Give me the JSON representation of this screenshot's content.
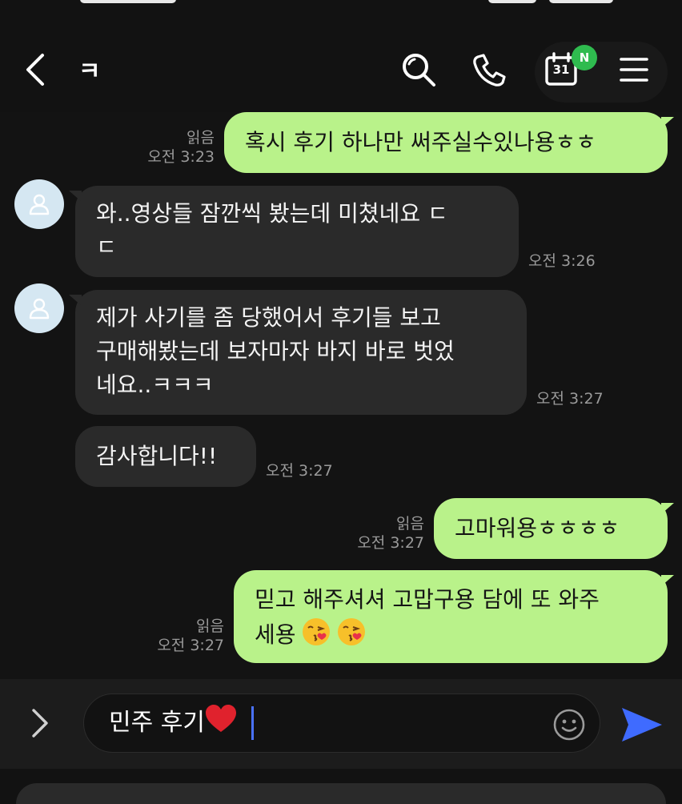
{
  "header": {
    "title": "ㅋ",
    "calendar_day": "31",
    "calendar_badge": "N"
  },
  "messages": [
    {
      "direction": "out",
      "text": "혹시 후기 하나만 써주실수있나용ㅎㅎ",
      "read": "읽음",
      "time": "오전 3:23"
    },
    {
      "direction": "in",
      "lines": [
        "와..영상들 잠깐씩 봤는데 미쳤네요 ㄷ",
        "ㄷ"
      ],
      "time": "오전 3:26"
    },
    {
      "direction": "in",
      "lines": [
        "제가 사기를 좀 당했어서 후기들 보고",
        "구매해봤는데 보자마자 바지 바로 벗었",
        "네요..ㅋㅋㅋ"
      ],
      "time": "오전 3:27"
    },
    {
      "direction": "in",
      "text": "감사합니다!!",
      "time": "오전 3:27"
    },
    {
      "direction": "out",
      "text": "고마워용ㅎㅎㅎㅎ",
      "read": "읽음",
      "time": "오전 3:27"
    },
    {
      "direction": "out",
      "lines": [
        "믿고 해주셔셔 고맙구용 담에 또 와주",
        "세용"
      ],
      "emoji": [
        "face-blowing-kiss",
        "face-blowing-kiss"
      ],
      "read": "읽음",
      "time": "오전 3:27"
    }
  ],
  "composer": {
    "text": "민주 후기",
    "emoji": "red-heart"
  },
  "colors": {
    "outgoing_bubble": "#b9f28a",
    "incoming_bubble": "#2a2a2a",
    "background": "#131313",
    "badge": "#2fbb4f",
    "send": "#3f6bff"
  }
}
